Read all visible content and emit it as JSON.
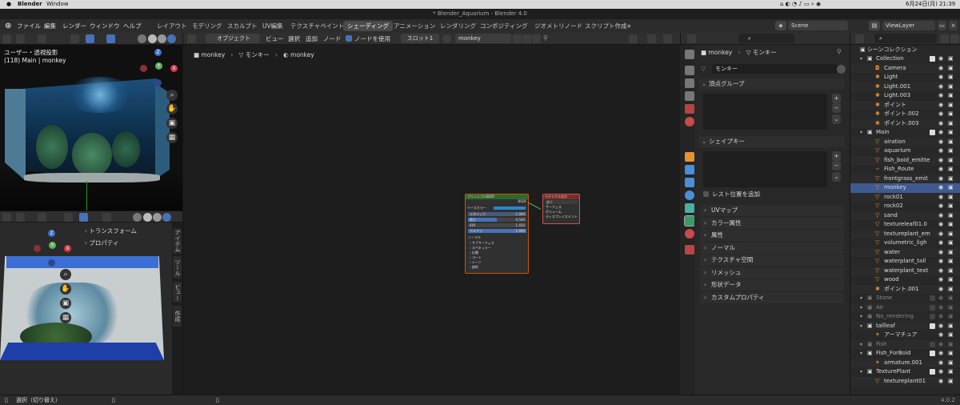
{
  "macos": {
    "app": "Blender",
    "menu": [
      "Window"
    ],
    "date_time": "6月24日(月) 21:39"
  },
  "window_title": "* Blender_Aquarium - Blender 4.0",
  "menus": [
    "ファイル",
    "編集",
    "レンダー",
    "ウィンドウ",
    "ヘルプ"
  ],
  "workspaces": [
    {
      "label": "レイアウト",
      "active": false
    },
    {
      "label": "モデリング",
      "active": false
    },
    {
      "label": "スカルプト",
      "active": false
    },
    {
      "label": "UV編集",
      "active": false
    },
    {
      "label": "テクスチャペイント",
      "active": false
    },
    {
      "label": "シェーディング",
      "active": true
    },
    {
      "label": "アニメーション",
      "active": false
    },
    {
      "label": "レンダリング",
      "active": false
    },
    {
      "label": "コンポジティング",
      "active": false
    },
    {
      "label": "ジオメトリノード",
      "active": false
    },
    {
      "label": "スクリプト作成",
      "active": false
    }
  ],
  "add_workspace": "+",
  "scene": {
    "label": "Scene"
  },
  "view_layer": {
    "label": "ViewLayer"
  },
  "viewport_top": {
    "view_name": "ユーザー・透視投影",
    "collection_info": "(118) Main | monkey",
    "gizmo": {
      "z": "Z",
      "x": "X",
      "y": "Y"
    }
  },
  "viewport_bottom": {
    "sidebar_panels": [
      "トランスフォーム",
      "プロパティ"
    ],
    "tabs": [
      "アイテム",
      "ツール",
      "ビュー",
      "作成"
    ],
    "gizmo": {
      "z": "Z",
      "x": "X",
      "y": "Y"
    }
  },
  "node_editor": {
    "header": {
      "object_mode": "オブジェクト",
      "menus": [
        "ビュー",
        "選択",
        "追加",
        "ノード"
      ],
      "use_nodes_label": "ノードを使用",
      "use_nodes": true,
      "slot": "スロット1",
      "material": "monkey"
    },
    "breadcrumb": [
      "monkey",
      "モンキー",
      "monkey"
    ],
    "bsdf_node": {
      "title": "プリンシプルBSDF",
      "output": "BSDF",
      "rows": [
        "ベースカラー",
        "メタリック",
        "粗さ",
        "IOR",
        "アルファ",
        "ノーマル",
        "サブサーフェス",
        "スペキュラー",
        "伝播",
        "コート",
        "シーン",
        "放射"
      ],
      "values": {
        "metallic": "1.000",
        "roughness": "0.500",
        "ior": "1.450",
        "alpha": "1.000"
      }
    },
    "output_node": {
      "title": "マテリアル出力",
      "target": "全て",
      "rows": [
        "サーフェス",
        "ボリューム",
        "ディスプレイスメント"
      ]
    }
  },
  "properties": {
    "object": "monkey",
    "data": "モンキー",
    "mesh_name": "モンキー",
    "vertex_groups": "頂点グループ",
    "shape_keys": "シェイプキー",
    "relative_label": "レスト位置を追加",
    "panels": [
      "UVマップ",
      "カラー属性",
      "属性",
      "ノーマル",
      "テクスチャ空間",
      "リメッシュ",
      "形状データ",
      "カスタムプロパティ"
    ]
  },
  "outliner": {
    "root": "シーンコレクション",
    "rows": [
      {
        "label": "Collection",
        "indent": 1,
        "type": "collection",
        "active": false,
        "dim": false
      },
      {
        "label": "Camera",
        "indent": 2,
        "type": "camera",
        "active": false,
        "dim": false
      },
      {
        "label": "Light",
        "indent": 2,
        "type": "light",
        "active": false,
        "dim": false
      },
      {
        "label": "Light.001",
        "indent": 2,
        "type": "light",
        "active": false,
        "dim": false
      },
      {
        "label": "Light.003",
        "indent": 2,
        "type": "light",
        "active": false,
        "dim": false
      },
      {
        "label": "ポイント",
        "indent": 2,
        "type": "light",
        "active": false,
        "dim": false
      },
      {
        "label": "ポイント.002",
        "indent": 2,
        "type": "light",
        "active": false,
        "dim": false
      },
      {
        "label": "ポイント.003",
        "indent": 2,
        "type": "light",
        "active": false,
        "dim": false
      },
      {
        "label": "Main",
        "indent": 1,
        "type": "collection",
        "active": false,
        "dim": false
      },
      {
        "label": "airation",
        "indent": 2,
        "type": "mesh",
        "active": false,
        "dim": false
      },
      {
        "label": "aquarium",
        "indent": 2,
        "type": "mesh",
        "active": false,
        "dim": false
      },
      {
        "label": "fish_boid_emitte",
        "indent": 2,
        "type": "mesh",
        "active": false,
        "dim": false
      },
      {
        "label": "Fish_Route",
        "indent": 2,
        "type": "curve",
        "active": false,
        "dim": false
      },
      {
        "label": "frontgrass_emit",
        "indent": 2,
        "type": "mesh",
        "active": false,
        "dim": false
      },
      {
        "label": "monkey",
        "indent": 2,
        "type": "mesh",
        "active": true,
        "dim": false
      },
      {
        "label": "rock01",
        "indent": 2,
        "type": "mesh",
        "active": false,
        "dim": false
      },
      {
        "label": "rock02",
        "indent": 2,
        "type": "mesh",
        "active": false,
        "dim": false
      },
      {
        "label": "sand",
        "indent": 2,
        "type": "mesh",
        "active": false,
        "dim": false
      },
      {
        "label": "textureleaf01.0",
        "indent": 2,
        "type": "mesh",
        "active": false,
        "dim": false
      },
      {
        "label": "textureplant_em",
        "indent": 2,
        "type": "mesh",
        "active": false,
        "dim": false
      },
      {
        "label": "volumetric_ligh",
        "indent": 2,
        "type": "mesh",
        "active": false,
        "dim": false
      },
      {
        "label": "water",
        "indent": 2,
        "type": "mesh",
        "active": false,
        "dim": false
      },
      {
        "label": "waterplant_tall",
        "indent": 2,
        "type": "mesh",
        "active": false,
        "dim": false
      },
      {
        "label": "waterplant_text",
        "indent": 2,
        "type": "mesh",
        "active": false,
        "dim": false
      },
      {
        "label": "wood",
        "indent": 2,
        "type": "mesh",
        "active": false,
        "dim": false
      },
      {
        "label": "ポイント.001",
        "indent": 2,
        "type": "light",
        "active": false,
        "dim": false
      },
      {
        "label": "Stone",
        "indent": 1,
        "type": "collection",
        "active": false,
        "dim": true
      },
      {
        "label": "Air",
        "indent": 1,
        "type": "collection",
        "active": false,
        "dim": true
      },
      {
        "label": "No_rendering",
        "indent": 1,
        "type": "collection",
        "active": false,
        "dim": true
      },
      {
        "label": "tallleaf",
        "indent": 1,
        "type": "collection",
        "active": false,
        "dim": false
      },
      {
        "label": "アーマチュア",
        "indent": 2,
        "type": "armature",
        "active": false,
        "dim": false
      },
      {
        "label": "Fish",
        "indent": 1,
        "type": "collection",
        "active": false,
        "dim": true
      },
      {
        "label": "Fish_ForBoid",
        "indent": 1,
        "type": "collection",
        "active": false,
        "dim": false
      },
      {
        "label": "armature.001",
        "indent": 2,
        "type": "armature",
        "active": false,
        "dim": false
      },
      {
        "label": "TexturePlant",
        "indent": 1,
        "type": "collection",
        "active": false,
        "dim": false
      },
      {
        "label": "textureplant01",
        "indent": 2,
        "type": "mesh",
        "active": false,
        "dim": false
      }
    ]
  },
  "status": {
    "left": "選択（切り替え）",
    "version": "4.0.2"
  },
  "colors": {
    "active_row": "#3e5a8f",
    "accent": "#4772b3",
    "orange": "#e8922e"
  }
}
